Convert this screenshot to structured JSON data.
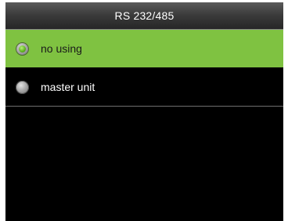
{
  "title": "RS 232/485",
  "options": [
    {
      "label": "no using",
      "selected": true
    },
    {
      "label": "master unit",
      "selected": false
    }
  ],
  "colors": {
    "selected_row": "#7fc241",
    "background": "#000000",
    "text": "#ffffff"
  },
  "icons": {
    "radio_selected": "radio-selected-icon",
    "radio_unselected": "radio-unselected-icon"
  }
}
